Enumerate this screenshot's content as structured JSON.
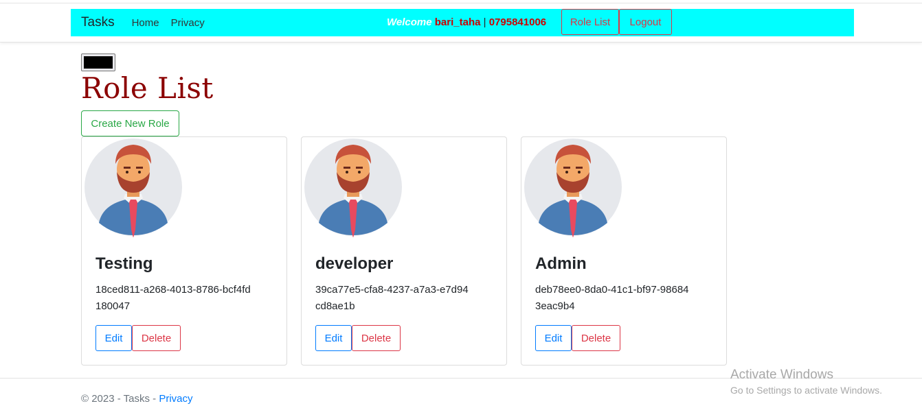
{
  "navbar": {
    "brand": "Tasks",
    "links": [
      "Home",
      "Privacy"
    ],
    "welcome_label": "Welcome",
    "username": "bari_taha",
    "separator": "|",
    "phone": "0795841006",
    "role_list_button": "Role List",
    "logout_button": "Logout",
    "background": "#00ffff"
  },
  "page": {
    "title": "Role List",
    "create_button": "Create New Role"
  },
  "roles": [
    {
      "name": "Testing",
      "id": "18ced811-a268-4013-8786-bcf4fd180047",
      "edit": "Edit",
      "delete": "Delete"
    },
    {
      "name": "developer",
      "id": "39ca77e5-cfa8-4237-a7a3-e7d94cd8ae1b",
      "edit": "Edit",
      "delete": "Delete"
    },
    {
      "name": "Admin",
      "id": "deb78ee0-8da0-41c1-bf97-986843eac9b4",
      "edit": "Edit",
      "delete": "Delete"
    }
  ],
  "footer": {
    "text": "© 2023 - Tasks - ",
    "privacy_link": "Privacy"
  },
  "watermark": {
    "line1": "Activate Windows",
    "line2": "Go to Settings to activate Windows."
  },
  "colors": {
    "title": "#8b0000",
    "primary": "#007bff",
    "danger": "#dc3545",
    "success": "#28a745"
  },
  "icons": {
    "avatar": "man-avatar-icon"
  }
}
